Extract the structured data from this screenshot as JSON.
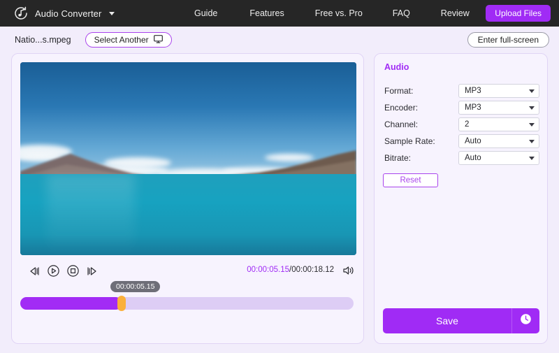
{
  "topbar": {
    "logo_icon": "convert-music-icon",
    "brand": "Audio Converter",
    "caret_icon": "chevron-down-icon",
    "links": [
      {
        "label": "Guide"
      },
      {
        "label": "Features"
      },
      {
        "label": "Free vs. Pro"
      },
      {
        "label": "FAQ"
      },
      {
        "label": "Review"
      }
    ],
    "upload_label": "Upload Files",
    "bg": "#262626",
    "accent": "#a02bf5"
  },
  "subbar": {
    "filename": "Natio...s.mpeg",
    "select_another_label": "Select Another",
    "select_another_icon": "monitor-icon",
    "fullscreen_label": "Enter full-screen"
  },
  "player": {
    "controls": [
      {
        "name": "rewind-icon"
      },
      {
        "name": "play-icon"
      },
      {
        "name": "stop-icon"
      },
      {
        "name": "forward-icon"
      }
    ],
    "current_time": "00:00:05.15",
    "time_separator": "/",
    "total_time": "00:00:18.12",
    "volume_icon": "volume-icon",
    "scrub_tooltip": "00:00:05.15",
    "progress_percent": 30.4,
    "handle_color": "#fbb03b",
    "fill_color": "#a22bf5",
    "track_color": "#ddcdf5"
  },
  "settings_panel": {
    "title": "Audio",
    "title_color": "#a02bf5",
    "rows": [
      {
        "label": "Format:",
        "value": "MP3"
      },
      {
        "label": "Encoder:",
        "value": "MP3"
      },
      {
        "label": "Channel:",
        "value": "2"
      },
      {
        "label": "Sample Rate:",
        "value": "Auto"
      },
      {
        "label": "Bitrate:",
        "value": "Auto"
      }
    ],
    "reset_label": "Reset",
    "save_label": "Save",
    "save_extra_icon": "clock-icon"
  }
}
